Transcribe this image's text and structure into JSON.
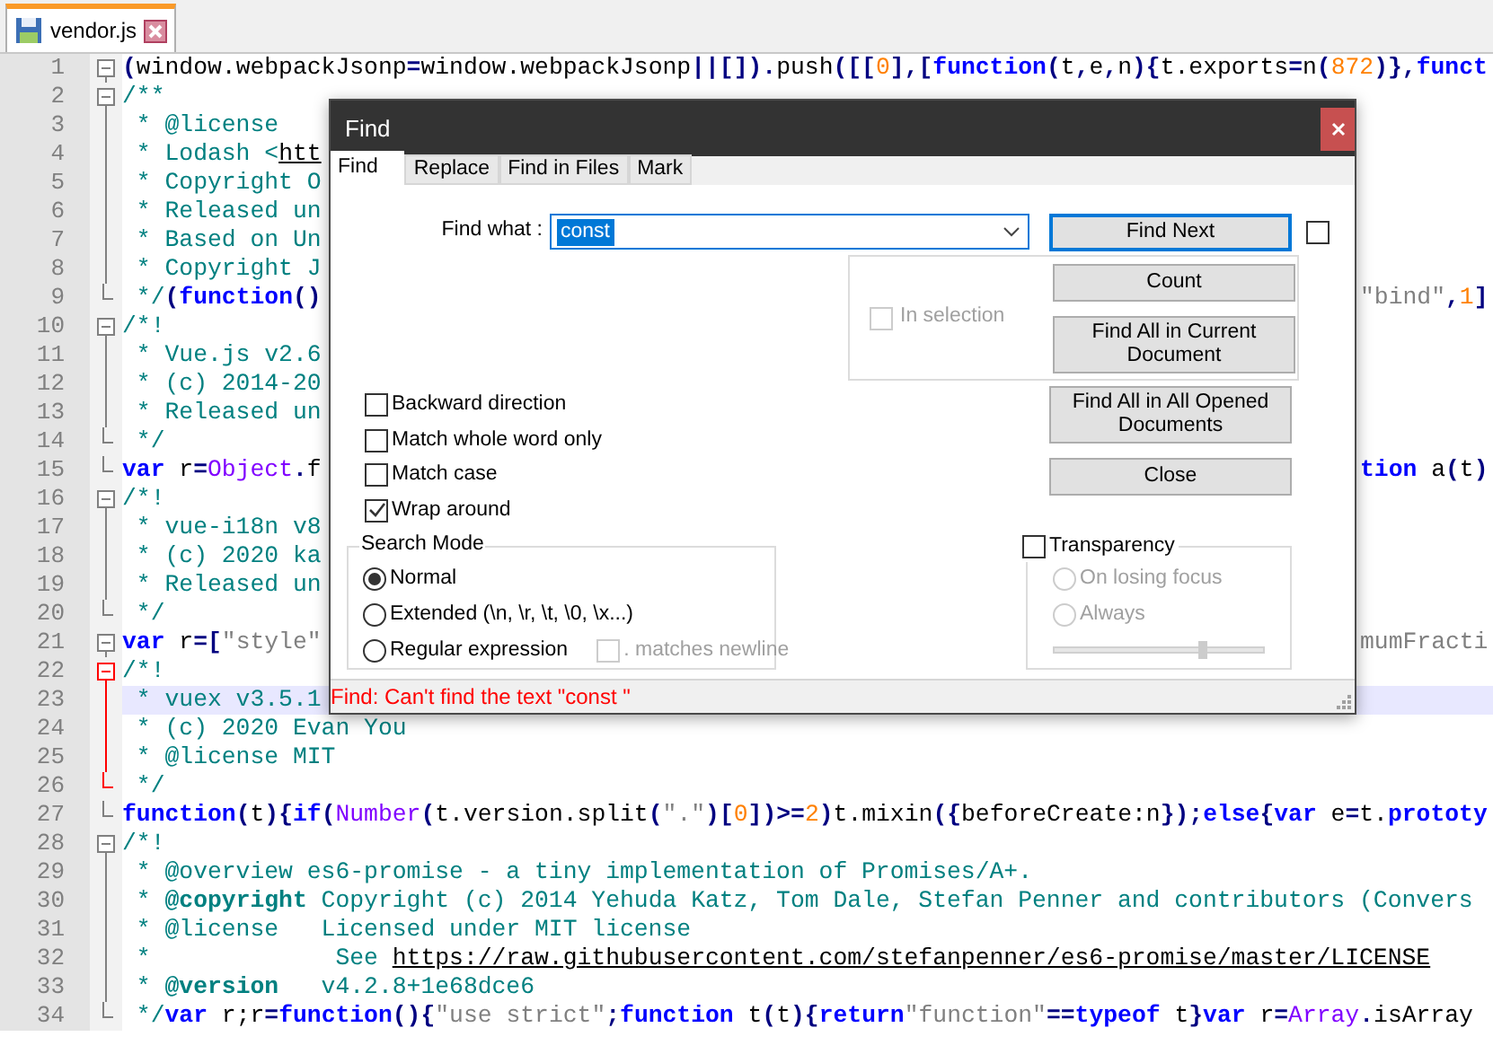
{
  "tabs": [
    {
      "label": "vendor.js",
      "selected": true
    }
  ],
  "lines": [
    {
      "number": "1",
      "kind": "head",
      "segments": [
        {
          "kind": "op",
          "text": "("
        },
        {
          "kind": "plain",
          "text": "window.webpackJsonp"
        },
        {
          "kind": "op",
          "text": "="
        },
        {
          "kind": "plain",
          "text": "window.webpackJsonp"
        },
        {
          "kind": "op",
          "text": "||[])."
        },
        {
          "kind": "plain",
          "text": "push"
        },
        {
          "kind": "op",
          "text": "([["
        },
        {
          "kind": "num",
          "text": "0"
        },
        {
          "kind": "op",
          "text": "],["
        },
        {
          "kind": "kw",
          "text": "function"
        },
        {
          "kind": "op",
          "text": "("
        },
        {
          "kind": "plain",
          "text": "t"
        },
        {
          "kind": "op",
          "text": ","
        },
        {
          "kind": "plain",
          "text": "e"
        },
        {
          "kind": "op",
          "text": ","
        },
        {
          "kind": "plain",
          "text": "n"
        },
        {
          "kind": "op",
          "text": "){"
        },
        {
          "kind": "plain",
          "text": "t.exports"
        },
        {
          "kind": "op",
          "text": "="
        },
        {
          "kind": "plain",
          "text": "n"
        },
        {
          "kind": "op",
          "text": "("
        },
        {
          "kind": "num",
          "text": "872"
        },
        {
          "kind": "op",
          "text": ")},"
        },
        {
          "kind": "kw",
          "text": "funct"
        }
      ]
    },
    {
      "number": "2",
      "kind": "head",
      "segments": [
        {
          "kind": "comment",
          "text": "/**"
        }
      ]
    },
    {
      "number": "3",
      "kind": "body",
      "segments": [
        {
          "kind": "comment",
          "text": " * @license"
        }
      ]
    },
    {
      "number": "4",
      "kind": "body",
      "segments": [
        {
          "kind": "comment",
          "text": " * Lodash <"
        },
        {
          "kind": "link",
          "text": "htt"
        }
      ]
    },
    {
      "number": "5",
      "kind": "body",
      "segments": [
        {
          "kind": "comment",
          "text": " * Copyright O"
        }
      ]
    },
    {
      "number": "6",
      "kind": "body",
      "segments": [
        {
          "kind": "comment",
          "text": " * Released un"
        }
      ]
    },
    {
      "number": "7",
      "kind": "body",
      "segments": [
        {
          "kind": "comment",
          "text": " * Based on Un"
        }
      ]
    },
    {
      "number": "8",
      "kind": "body",
      "segments": [
        {
          "kind": "comment",
          "text": " * Copyright J"
        }
      ]
    },
    {
      "number": "9",
      "kind": "tail",
      "segments": [
        {
          "kind": "comment",
          "text": " */"
        },
        {
          "kind": "op",
          "text": "("
        },
        {
          "kind": "kw",
          "text": "function"
        },
        {
          "kind": "op",
          "text": "()"
        }
      ],
      "right": [
        {
          "kind": "str",
          "text": "\"bind\""
        },
        {
          "kind": "op",
          "text": ","
        },
        {
          "kind": "num",
          "text": "1"
        },
        {
          "kind": "op",
          "text": "]"
        }
      ]
    },
    {
      "number": "10",
      "kind": "head",
      "segments": [
        {
          "kind": "comment",
          "text": "/*!"
        }
      ]
    },
    {
      "number": "11",
      "kind": "body",
      "segments": [
        {
          "kind": "comment",
          "text": " * Vue.js v2.6"
        }
      ]
    },
    {
      "number": "12",
      "kind": "body",
      "segments": [
        {
          "kind": "comment",
          "text": " * (c) 2014-20"
        }
      ]
    },
    {
      "number": "13",
      "kind": "body",
      "segments": [
        {
          "kind": "comment",
          "text": " * Released un"
        }
      ]
    },
    {
      "number": "14",
      "kind": "tail",
      "segments": [
        {
          "kind": "comment",
          "text": " */"
        }
      ]
    },
    {
      "number": "15",
      "kind": "tail",
      "segments": [
        {
          "kind": "kw",
          "text": "var"
        },
        {
          "kind": "plain",
          "text": " r"
        },
        {
          "kind": "op",
          "text": "="
        },
        {
          "kind": "cls",
          "text": "Object"
        },
        {
          "kind": "op",
          "text": "."
        },
        {
          "kind": "plain",
          "text": "f"
        }
      ],
      "right": [
        {
          "kind": "kw",
          "text": "tion"
        },
        {
          "kind": "plain",
          "text": " a"
        },
        {
          "kind": "op",
          "text": "("
        },
        {
          "kind": "plain",
          "text": "t"
        },
        {
          "kind": "op",
          "text": ")"
        }
      ]
    },
    {
      "number": "16",
      "kind": "head",
      "segments": [
        {
          "kind": "comment",
          "text": "/*!"
        }
      ]
    },
    {
      "number": "17",
      "kind": "body",
      "segments": [
        {
          "kind": "comment",
          "text": " * vue-i18n v8"
        }
      ]
    },
    {
      "number": "18",
      "kind": "body",
      "segments": [
        {
          "kind": "comment",
          "text": " * (c) 2020 ka"
        }
      ]
    },
    {
      "number": "19",
      "kind": "body",
      "segments": [
        {
          "kind": "comment",
          "text": " * Released un"
        }
      ]
    },
    {
      "number": "20",
      "kind": "tail",
      "segments": [
        {
          "kind": "comment",
          "text": " */"
        }
      ]
    },
    {
      "number": "21",
      "kind": "head",
      "segments": [
        {
          "kind": "kw",
          "text": "var"
        },
        {
          "kind": "plain",
          "text": " r"
        },
        {
          "kind": "op",
          "text": "=["
        },
        {
          "kind": "str",
          "text": "\"style\""
        }
      ],
      "right": [
        {
          "kind": "str",
          "text": "mumFracti"
        }
      ]
    },
    {
      "number": "22",
      "kind": "head",
      "fold_active": true,
      "segments": [
        {
          "kind": "comment",
          "text": "/*!"
        }
      ]
    },
    {
      "number": "23",
      "kind": "body",
      "fold_active": true,
      "current": true,
      "segments": [
        {
          "kind": "comment",
          "text": " * vuex v3.5.1"
        }
      ]
    },
    {
      "number": "24",
      "kind": "body",
      "fold_active": true,
      "segments": [
        {
          "kind": "comment",
          "text": " * (c) 2020 Evan You"
        }
      ]
    },
    {
      "number": "25",
      "kind": "body",
      "fold_active": true,
      "segments": [
        {
          "kind": "comment",
          "text": " * @license MIT"
        }
      ]
    },
    {
      "number": "26",
      "kind": "tail",
      "fold_active": true,
      "segments": [
        {
          "kind": "comment",
          "text": " */"
        }
      ]
    },
    {
      "number": "27",
      "kind": "tail",
      "segments": [
        {
          "kind": "kw",
          "text": "function"
        },
        {
          "kind": "op",
          "text": "("
        },
        {
          "kind": "plain",
          "text": "t"
        },
        {
          "kind": "op",
          "text": "){"
        },
        {
          "kind": "kw",
          "text": "if"
        },
        {
          "kind": "op",
          "text": "("
        },
        {
          "kind": "cls",
          "text": "Number"
        },
        {
          "kind": "op",
          "text": "("
        },
        {
          "kind": "plain",
          "text": "t.version.split"
        },
        {
          "kind": "op",
          "text": "("
        },
        {
          "kind": "str",
          "text": "\".\""
        },
        {
          "kind": "op",
          "text": ")["
        },
        {
          "kind": "num",
          "text": "0"
        },
        {
          "kind": "op",
          "text": "])>="
        },
        {
          "kind": "num",
          "text": "2"
        },
        {
          "kind": "op",
          "text": ")"
        },
        {
          "kind": "plain",
          "text": "t.mixin"
        },
        {
          "kind": "op",
          "text": "({"
        },
        {
          "kind": "plain",
          "text": "beforeCreate:n"
        },
        {
          "kind": "op",
          "text": "});"
        },
        {
          "kind": "kw",
          "text": "else"
        },
        {
          "kind": "op",
          "text": "{"
        },
        {
          "kind": "kw",
          "text": "var"
        },
        {
          "kind": "plain",
          "text": " e"
        },
        {
          "kind": "op",
          "text": "="
        },
        {
          "kind": "plain",
          "text": "t."
        },
        {
          "kind": "kw",
          "text": "prototy"
        }
      ]
    },
    {
      "number": "28",
      "kind": "head",
      "segments": [
        {
          "kind": "comment",
          "text": "/*!"
        }
      ]
    },
    {
      "number": "29",
      "kind": "body",
      "segments": [
        {
          "kind": "comment",
          "text": " * @overview es6-promise - a tiny implementation of Promises/A+."
        }
      ]
    },
    {
      "number": "30",
      "kind": "body",
      "segments": [
        {
          "kind": "comment",
          "text": " * "
        },
        {
          "kind": "doctag",
          "text": "@copyright"
        },
        {
          "kind": "comment",
          "text": " Copyright (c) 2014 Yehuda Katz, Tom Dale, Stefan Penner and contributors (Convers"
        }
      ]
    },
    {
      "number": "31",
      "kind": "body",
      "segments": [
        {
          "kind": "comment",
          "text": " * @license   Licensed under MIT license"
        }
      ]
    },
    {
      "number": "32",
      "kind": "body",
      "segments": [
        {
          "kind": "comment",
          "text": " *             See "
        },
        {
          "kind": "link",
          "text": "https://raw.githubusercontent.com/stefanpenner/es6-promise/master/LICENSE"
        }
      ]
    },
    {
      "number": "33",
      "kind": "body",
      "segments": [
        {
          "kind": "comment",
          "text": " * "
        },
        {
          "kind": "doctag",
          "text": "@version"
        },
        {
          "kind": "comment",
          "text": "   v4.2.8+1e68dce6"
        }
      ]
    },
    {
      "number": "34",
      "kind": "tail",
      "segments": [
        {
          "kind": "comment",
          "text": " */"
        },
        {
          "kind": "kw",
          "text": "var"
        },
        {
          "kind": "plain",
          "text": " r;r"
        },
        {
          "kind": "op",
          "text": "="
        },
        {
          "kind": "kw",
          "text": "function"
        },
        {
          "kind": "op",
          "text": "(){"
        },
        {
          "kind": "str",
          "text": "\"use strict\""
        },
        {
          "kind": "op",
          "text": ";"
        },
        {
          "kind": "kw",
          "text": "function"
        },
        {
          "kind": "plain",
          "text": " t"
        },
        {
          "kind": "op",
          "text": "("
        },
        {
          "kind": "plain",
          "text": "t"
        },
        {
          "kind": "op",
          "text": "){"
        },
        {
          "kind": "kw",
          "text": "return"
        },
        {
          "kind": "str",
          "text": "\"function\""
        },
        {
          "kind": "op",
          "text": "=="
        },
        {
          "kind": "kw",
          "text": "typeof"
        },
        {
          "kind": "plain",
          "text": " t"
        },
        {
          "kind": "op",
          "text": "}"
        },
        {
          "kind": "kw",
          "text": "var"
        },
        {
          "kind": "plain",
          "text": " r"
        },
        {
          "kind": "op",
          "text": "="
        },
        {
          "kind": "cls",
          "text": "Array"
        },
        {
          "kind": "op",
          "text": "."
        },
        {
          "kind": "plain",
          "text": "isArray"
        }
      ]
    }
  ],
  "find_dialog": {
    "title": "Find",
    "tabs": [
      {
        "label": "Find",
        "selected": true
      },
      {
        "label": "Replace",
        "selected": false
      },
      {
        "label": "Find in Files",
        "selected": false
      },
      {
        "label": "Mark",
        "selected": false
      }
    ],
    "find_what": {
      "label": "Find what :",
      "value": "const"
    },
    "find_next": "Find Next",
    "side_checkbox": {
      "checked": false
    },
    "in_selection": {
      "label": "In selection",
      "checked": false,
      "disabled": true
    },
    "buttons": [
      "Count",
      "Find All in Current Document",
      "Find All in All Opened Documents",
      "Close"
    ],
    "options": [
      {
        "label": "Backward direction",
        "checked": false
      },
      {
        "label": "Match whole word only",
        "checked": false
      },
      {
        "label": "Match case",
        "checked": false
      },
      {
        "label": "Wrap around",
        "checked": true
      }
    ],
    "search_mode": {
      "title": "Search Mode",
      "options": [
        {
          "label": "Normal",
          "selected": true
        },
        {
          "label": "Extended (\\n, \\r, \\t, \\0, \\x...)",
          "selected": false
        },
        {
          "label": "Regular expression",
          "selected": false
        }
      ],
      "matches_newline": {
        "label": ". matches newline",
        "checked": false,
        "disabled": true
      }
    },
    "transparency": {
      "label": "Transparency",
      "checked": false,
      "options": [
        {
          "label": "On losing focus",
          "selected": false,
          "disabled": true
        },
        {
          "label": "Always",
          "selected": false,
          "disabled": true
        }
      ],
      "slider": {
        "level": 0.7
      }
    },
    "status": "Find: Can't find the text \"const \""
  }
}
